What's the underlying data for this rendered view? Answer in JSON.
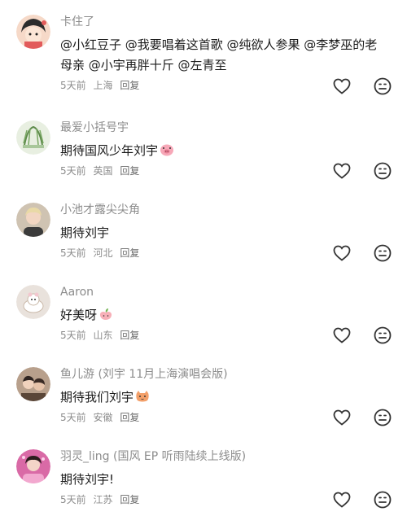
{
  "comments": [
    {
      "username": "卡住了",
      "text": "@小红豆子 @我要唱着这首歌 @纯欲人参果 @李梦巫的老母亲 @小宇再胖十斤 @左青至",
      "time": "5天前",
      "location": "上海",
      "reply": "回复",
      "emoji": ""
    },
    {
      "username": "最爱小括号宇",
      "text": "期待国风少年刘宇",
      "time": "5天前",
      "location": "英国",
      "reply": "回复",
      "emoji": "pig-face-emoji"
    },
    {
      "username": "小池才露尖尖角",
      "text": "期待刘宇",
      "time": "5天前",
      "location": "河北",
      "reply": "回复",
      "emoji": ""
    },
    {
      "username": "Aaron",
      "text": "好美呀",
      "time": "5天前",
      "location": "山东",
      "reply": "回复",
      "emoji": "peach-emoji"
    },
    {
      "username": "鱼儿游 (刘宇 11月上海演唱会版)",
      "text": "期待我们刘宇",
      "time": "5天前",
      "location": "安徽",
      "reply": "回复",
      "emoji": "cat-face-emoji"
    },
    {
      "username": "羽灵_ling (国风 EP 听雨陆续上线版)",
      "text": "期待刘宇!",
      "time": "5天前",
      "location": "江苏",
      "reply": "回复",
      "emoji": ""
    }
  ],
  "icons": {
    "like": "heart-outline-icon",
    "emoji_react": "smiley-outline-icon"
  },
  "colors": {
    "username": "#8c8c8c",
    "text": "#1a1a1a",
    "meta": "#8c8c8c",
    "icon": "#333333"
  }
}
